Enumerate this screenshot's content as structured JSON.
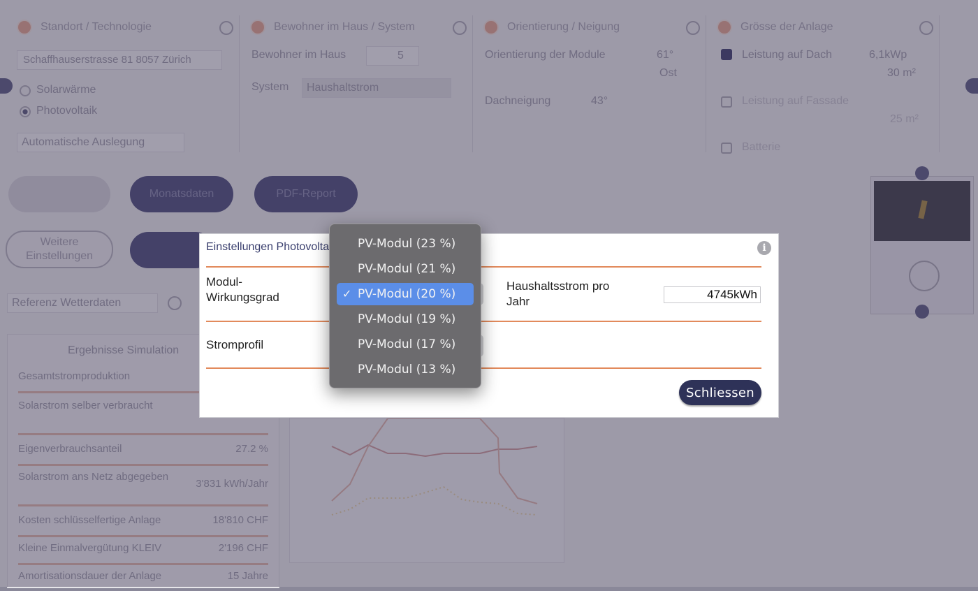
{
  "background": {
    "panels": [
      {
        "title": "Standort / Technologie"
      },
      {
        "title": "Bewohner im Haus / System"
      },
      {
        "title": "Orientierung / Neigung"
      },
      {
        "title": "Grösse der Anlage"
      }
    ],
    "address": "Schaffhauserstrasse 81 8057 Zürich",
    "tech_options": [
      "Solarwärme",
      "Photovoltaik"
    ],
    "auto_design": "Automatische Auslegung",
    "residents_label": "Bewohner im Haus",
    "residents_value": "5",
    "system_label": "System",
    "system_value": "Haushaltstrom",
    "module_orientation_label": "Orientierung der Module",
    "module_orientation_value": "61°",
    "module_orientation_dir": "Ost",
    "roof_slope_label": "Dachneigung",
    "roof_slope_value": "43°",
    "roof_power_label": "Leistung auf Dach",
    "roof_power_value": "6,1kWp",
    "roof_area": "30 m²",
    "facade_power_label": "Leistung auf Fassade",
    "facade_area": "25 m²",
    "battery_label": "Batterie",
    "buttons": {
      "monthly": "Monatsdaten",
      "pdf": "PDF-Report",
      "more_settings": "Weitere Einstellungen"
    },
    "weather_select": "Referenz Wetterdaten",
    "results_title": "Ergebnisse Simulation",
    "results": [
      {
        "label": "Gesamtstromproduktion",
        "value": ""
      },
      {
        "label": "Solarstrom selber verbraucht",
        "value": ""
      },
      {
        "label": "Eigenverbrauchsanteil",
        "value": "27.2 %"
      },
      {
        "label": "Solarstrom ans Netz abgegeben",
        "value": "3'831 kWh/Jahr"
      },
      {
        "label": "Kosten schlüsselfertige Anlage",
        "value": "18'810 CHF"
      },
      {
        "label": "Kleine Einmalvergütung KLEIV",
        "value": "2'196 CHF"
      },
      {
        "label": "Amortisationsdauer der Anlage",
        "value": "15 Jahre"
      }
    ]
  },
  "modal": {
    "title": "Einstellungen Photovoltaik",
    "efficiency_label_line1": "Modul-",
    "efficiency_label_line2": "Wirkungsgrad",
    "household_label_line1": "Haushaltsstrom pro",
    "household_label_line2": "Jahr",
    "household_value": "4745kWh",
    "profile_label": "Stromprofil",
    "close_label": "Schliessen"
  },
  "dropdown": {
    "selected_index": 2,
    "check_glyph": "✓",
    "options": [
      "PV-Modul (23 %)",
      "PV-Modul (21 %)",
      "PV-Modul (20 %)",
      "PV-Modul (19 %)",
      "PV-Modul (17 %)",
      "PV-Modul (13 %)"
    ]
  },
  "colors": {
    "accent": "#e28a5c",
    "button_dark": "#2e3258",
    "selection": "#5b8ee8",
    "menu_bg": "#6c6b6e"
  }
}
